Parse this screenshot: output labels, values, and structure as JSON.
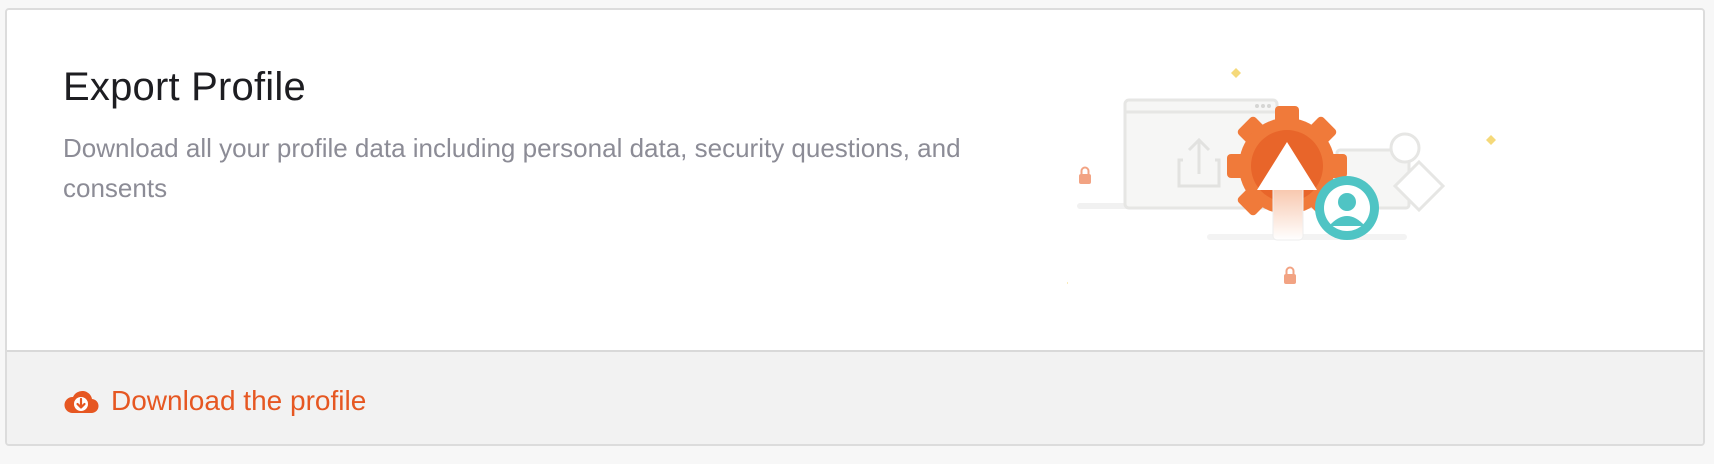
{
  "card": {
    "title": "Export Profile",
    "description": "Download all your profile data including personal data, security questions, and consents"
  },
  "footer": {
    "download_label": "Download the profile",
    "download_icon": "cloud-download-icon"
  },
  "illustration": {
    "name": "export-profile-illustration",
    "icons": [
      "gear-icon",
      "upload-arrow-icon",
      "user-avatar-icon",
      "lock-icon",
      "sparkle-icon",
      "browser-window-icon"
    ]
  },
  "colors": {
    "accent": "#e65722",
    "gear_orange": "#f07a3a",
    "avatar_teal": "#4fc4c4",
    "sparkle_yellow": "#f5d97a",
    "title": "#1d1d21",
    "description": "#8c8c96",
    "footer_bg": "#f2f2f2"
  }
}
